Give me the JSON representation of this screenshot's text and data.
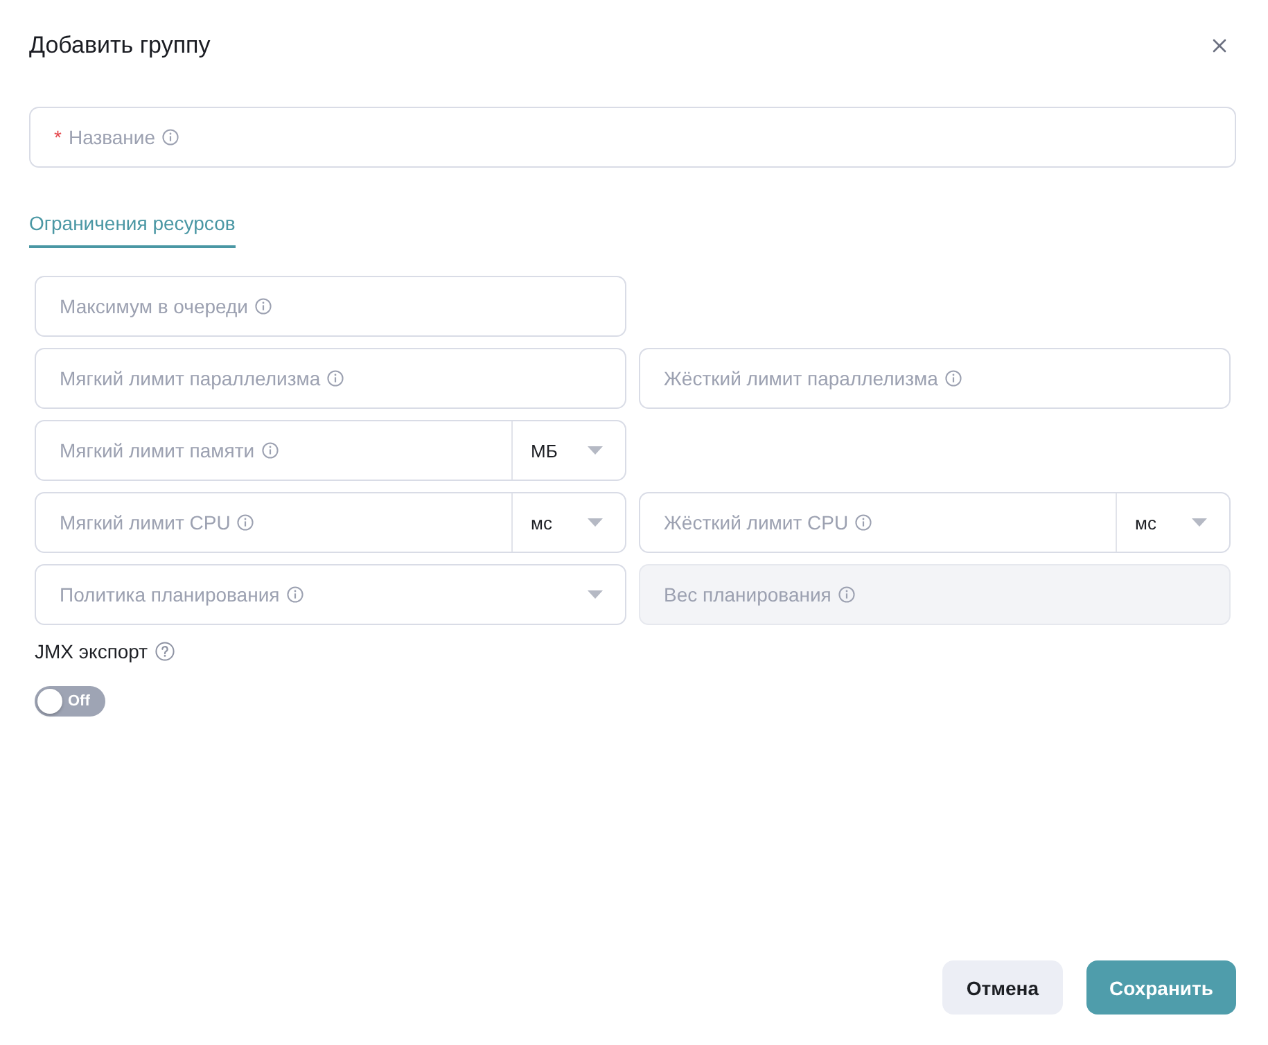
{
  "dialog": {
    "title": "Добавить группу"
  },
  "name_field": {
    "required_mark": "*",
    "placeholder": "Название"
  },
  "tabs": [
    {
      "label": "Ограничения ресурсов",
      "selected": true
    }
  ],
  "rows": [
    {
      "left": {
        "kind": "input",
        "placeholder": "Максимум в очереди",
        "disabled": false
      }
    },
    {
      "left": {
        "kind": "input",
        "placeholder": "Мягкий лимит параллелизма",
        "disabled": false
      },
      "right": {
        "kind": "input",
        "placeholder": "Жёсткий лимит параллелизма",
        "disabled": false
      }
    },
    {
      "left": {
        "kind": "unit",
        "placeholder": "Мягкий лимит памяти",
        "unit": "МБ",
        "disabled": false
      }
    },
    {
      "left": {
        "kind": "unit",
        "placeholder": "Мягкий лимит CPU",
        "unit": "мс",
        "disabled": false
      },
      "right": {
        "kind": "unit",
        "placeholder": "Жёсткий лимит CPU",
        "unit": "мс",
        "disabled": false
      }
    },
    {
      "left": {
        "kind": "select",
        "placeholder": "Политика планирования",
        "disabled": false
      },
      "right": {
        "kind": "input",
        "placeholder": "Вес планирования",
        "disabled": true
      }
    }
  ],
  "jmx_export": {
    "label": "JMX экспорт",
    "toggle": {
      "on": false,
      "label": "Off"
    }
  },
  "buttons": [
    {
      "label": "Отмена",
      "kind": "secondary"
    },
    {
      "label": "Сохранить",
      "kind": "primary"
    }
  ]
}
